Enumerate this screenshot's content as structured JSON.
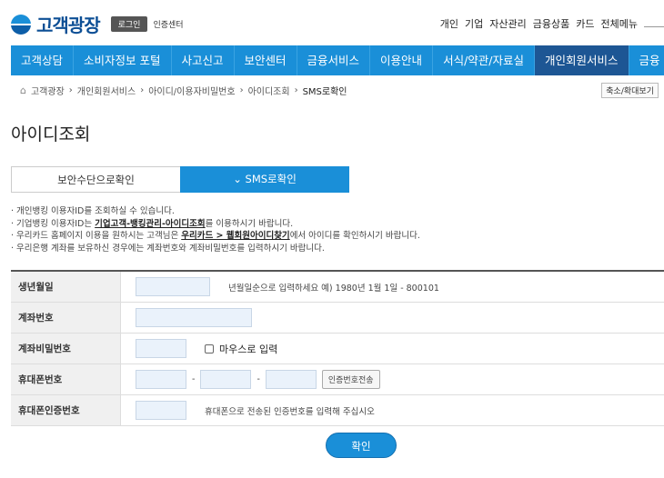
{
  "header": {
    "logo": "고객광장",
    "login": "로그인",
    "cert": "인증센터",
    "top_menu": [
      "개인",
      "기업",
      "자산관리",
      "금융상품",
      "카드",
      "전체메뉴"
    ]
  },
  "nav": [
    "고객상담",
    "소비자정보 포털",
    "사고신고",
    "보안센터",
    "금융서비스",
    "이용안내",
    "서식/약관/자료실",
    "개인회원서비스",
    "금융"
  ],
  "nav_active": 7,
  "breadcrumb": [
    "고객광장",
    "개인회원서비스",
    "아이디/이용자비밀번호",
    "아이디조회",
    "SMS로확인"
  ],
  "zoom_btn": "축소/확대보기",
  "page_title": "아이디조회",
  "tabs": [
    "보안수단으로확인",
    "SMS로확인"
  ],
  "bullets": {
    "b1": "개인뱅킹 이용자ID를 조회하실 수 있습니다.",
    "b2a": "기업뱅킹 이용자ID는 ",
    "b2link": "기업고객-뱅킹관리-아이디조회",
    "b2b": "를 이용하시기 바랍니다.",
    "b3a": "우리카드 홈페이지 이용을 원하시는 고객님은 ",
    "b3link": "우리카드 > 웹회원아이디찾기",
    "b3b": "에서 아이디를 확인하시기 바랍니다.",
    "b4": "우리은행 계좌를 보유하신 경우에는 계좌번호와 계좌비밀번호를 입력하시기 바랍니다."
  },
  "form": {
    "birth": {
      "label": "생년월일",
      "hint": "년월일순으로 입력하세요 예) 1980년 1월 1일 - 800101"
    },
    "account": {
      "label": "계좌번호"
    },
    "password": {
      "label": "계좌비밀번호",
      "mouse": "마우스로 입력"
    },
    "phone": {
      "label": "휴대폰번호",
      "sep": "-",
      "send": "인증번호전송"
    },
    "auth": {
      "label": "휴대폰인증번호",
      "hint": "휴대폰으로 전송된 인증번호를 입력해 주십시오"
    }
  },
  "confirm": "확인",
  "colors": {
    "nav": "#1a8fd8",
    "nav_active": "#1d5694",
    "input": "#eaf2fb"
  }
}
